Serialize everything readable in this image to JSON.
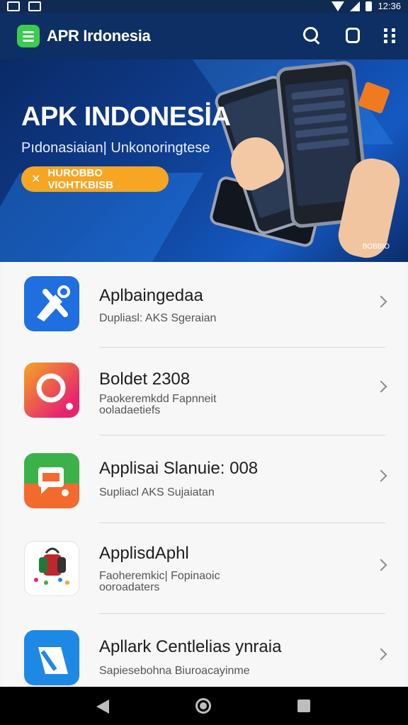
{
  "status_bar": {
    "time": "12:36"
  },
  "app_bar": {
    "title": "APR Irdonesia",
    "icons": [
      "logo-icon",
      "search-icon",
      "square-icon",
      "more-icon"
    ]
  },
  "banner": {
    "headline": "APK INDONESİA",
    "subtitle": "Pıdonasiaian| Unkonoringtese",
    "cta_label": "HUROBBO VIOHTKBISB",
    "credit": "BOBBIO"
  },
  "apps": [
    {
      "title": "Aplbaingedaa",
      "desc": "Dupliasl: AKS Sgeraian",
      "chev": "chevron-right-icon"
    },
    {
      "title": "Boldet 2308",
      "desc": "Paokeremkdd Fapnneit\nooladaetiefs",
      "chev": "chevron-right-icon"
    },
    {
      "title": "Applisai Slanuie:   008",
      "desc": "Supliacl AKS Sujaiatan",
      "chev": "chevron-right-icon"
    },
    {
      "title": "ApplisdAphl",
      "desc": "Faoheremkic| Fopinaoic\nooroadaters",
      "chev": "chevron-right-icon"
    },
    {
      "title": "Apllark Centlelias ynraia",
      "desc": "Sapiesebohna Biuroacayinme",
      "chev": "chevron-right-icon"
    }
  ],
  "colors": {
    "appbar": "#0d2f63",
    "cta": "#f6a623",
    "icon1": "#1f6fe0",
    "icon2_from": "#f5a623",
    "icon2_to": "#e6246f",
    "icon3": "#3cb14a",
    "icon4": "#ffffff",
    "icon5": "#1e88e5"
  }
}
